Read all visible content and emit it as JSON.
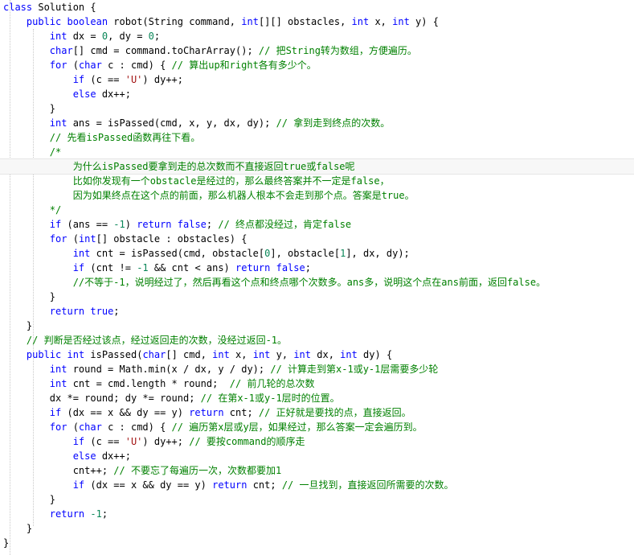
{
  "editor": {
    "language": "java",
    "current_line_index": 11,
    "lines": [
      [
        {
          "t": "class",
          "k": "k"
        },
        {
          "t": " Solution {",
          "k": "n"
        }
      ],
      [
        {
          "t": "    ",
          "k": "n"
        },
        {
          "t": "public",
          "k": "k"
        },
        {
          "t": " ",
          "k": "n"
        },
        {
          "t": "boolean",
          "k": "k"
        },
        {
          "t": " robot(String command, ",
          "k": "n"
        },
        {
          "t": "int",
          "k": "k"
        },
        {
          "t": "[][] obstacles, ",
          "k": "n"
        },
        {
          "t": "int",
          "k": "k"
        },
        {
          "t": " x, ",
          "k": "n"
        },
        {
          "t": "int",
          "k": "k"
        },
        {
          "t": " y) {",
          "k": "n"
        }
      ],
      [
        {
          "t": "        ",
          "k": "n"
        },
        {
          "t": "int",
          "k": "k"
        },
        {
          "t": " dx = ",
          "k": "n"
        },
        {
          "t": "0",
          "k": "num"
        },
        {
          "t": ", dy = ",
          "k": "n"
        },
        {
          "t": "0",
          "k": "num"
        },
        {
          "t": ";",
          "k": "n"
        }
      ],
      [
        {
          "t": "        ",
          "k": "n"
        },
        {
          "t": "char",
          "k": "k"
        },
        {
          "t": "[] cmd = command.toCharArray(); ",
          "k": "n"
        },
        {
          "t": "// 把String转为数组，方便遍历。",
          "k": "c"
        }
      ],
      [
        {
          "t": "        ",
          "k": "n"
        },
        {
          "t": "for",
          "k": "k"
        },
        {
          "t": " (",
          "k": "n"
        },
        {
          "t": "char",
          "k": "k"
        },
        {
          "t": " c : cmd) { ",
          "k": "n"
        },
        {
          "t": "// 算出up和right各有多少个。",
          "k": "c"
        }
      ],
      [
        {
          "t": "            ",
          "k": "n"
        },
        {
          "t": "if",
          "k": "k"
        },
        {
          "t": " (c == ",
          "k": "n"
        },
        {
          "t": "'U'",
          "k": "s"
        },
        {
          "t": ") dy++;",
          "k": "n"
        }
      ],
      [
        {
          "t": "            ",
          "k": "n"
        },
        {
          "t": "else",
          "k": "k"
        },
        {
          "t": " dx++;",
          "k": "n"
        }
      ],
      [
        {
          "t": "        }",
          "k": "n"
        }
      ],
      [
        {
          "t": "        ",
          "k": "n"
        },
        {
          "t": "int",
          "k": "k"
        },
        {
          "t": " ans = isPassed(cmd, x, y, dx, dy); ",
          "k": "n"
        },
        {
          "t": "// 拿到走到终点的次数。",
          "k": "c"
        }
      ],
      [
        {
          "t": "        ",
          "k": "n"
        },
        {
          "t": "// 先看isPassed函数再往下看。",
          "k": "c"
        }
      ],
      [
        {
          "t": "        ",
          "k": "n"
        },
        {
          "t": "/*",
          "k": "c"
        }
      ],
      [
        {
          "t": "            ",
          "k": "n"
        },
        {
          "t": "为什么isPassed要拿到走的总次数而不直接返回true或false呢",
          "k": "c"
        }
      ],
      [
        {
          "t": "            ",
          "k": "n"
        },
        {
          "t": "比如你发现有一个obstacle是经过的，那么最终答案并不一定是false，",
          "k": "c"
        }
      ],
      [
        {
          "t": "            ",
          "k": "n"
        },
        {
          "t": "因为如果终点在这个点的前面，那么机器人根本不会走到那个点。答案是true。",
          "k": "c"
        }
      ],
      [
        {
          "t": "        ",
          "k": "n"
        },
        {
          "t": "*/",
          "k": "c"
        }
      ],
      [
        {
          "t": "        ",
          "k": "n"
        },
        {
          "t": "if",
          "k": "k"
        },
        {
          "t": " (ans == ",
          "k": "n"
        },
        {
          "t": "-1",
          "k": "num"
        },
        {
          "t": ") ",
          "k": "n"
        },
        {
          "t": "return",
          "k": "k"
        },
        {
          "t": " ",
          "k": "n"
        },
        {
          "t": "false",
          "k": "k"
        },
        {
          "t": "; ",
          "k": "n"
        },
        {
          "t": "// 终点都没经过，肯定false",
          "k": "c"
        }
      ],
      [
        {
          "t": "        ",
          "k": "n"
        },
        {
          "t": "for",
          "k": "k"
        },
        {
          "t": " (",
          "k": "n"
        },
        {
          "t": "int",
          "k": "k"
        },
        {
          "t": "[] obstacle : obstacles) {",
          "k": "n"
        }
      ],
      [
        {
          "t": "            ",
          "k": "n"
        },
        {
          "t": "int",
          "k": "k"
        },
        {
          "t": " cnt = isPassed(cmd, obstacle[",
          "k": "n"
        },
        {
          "t": "0",
          "k": "num"
        },
        {
          "t": "], obstacle[",
          "k": "n"
        },
        {
          "t": "1",
          "k": "num"
        },
        {
          "t": "], dx, dy);",
          "k": "n"
        }
      ],
      [
        {
          "t": "            ",
          "k": "n"
        },
        {
          "t": "if",
          "k": "k"
        },
        {
          "t": " (cnt != ",
          "k": "n"
        },
        {
          "t": "-1",
          "k": "num"
        },
        {
          "t": " && cnt < ans) ",
          "k": "n"
        },
        {
          "t": "return",
          "k": "k"
        },
        {
          "t": " ",
          "k": "n"
        },
        {
          "t": "false",
          "k": "k"
        },
        {
          "t": ";",
          "k": "n"
        }
      ],
      [
        {
          "t": "            ",
          "k": "n"
        },
        {
          "t": "//不等于-1，说明经过了，然后再看这个点和终点哪个次数多。ans多，说明这个点在ans前面，返回false。",
          "k": "c"
        }
      ],
      [
        {
          "t": "        }",
          "k": "n"
        }
      ],
      [
        {
          "t": "        ",
          "k": "n"
        },
        {
          "t": "return",
          "k": "k"
        },
        {
          "t": " ",
          "k": "n"
        },
        {
          "t": "true",
          "k": "k"
        },
        {
          "t": ";",
          "k": "n"
        }
      ],
      [
        {
          "t": "    }",
          "k": "n"
        }
      ],
      [
        {
          "t": "    ",
          "k": "n"
        },
        {
          "t": "// 判断是否经过该点，经过返回走的次数，没经过返回-1。",
          "k": "c"
        }
      ],
      [
        {
          "t": "    ",
          "k": "n"
        },
        {
          "t": "public",
          "k": "k"
        },
        {
          "t": " ",
          "k": "n"
        },
        {
          "t": "int",
          "k": "k"
        },
        {
          "t": " isPassed(",
          "k": "n"
        },
        {
          "t": "char",
          "k": "k"
        },
        {
          "t": "[] cmd, ",
          "k": "n"
        },
        {
          "t": "int",
          "k": "k"
        },
        {
          "t": " x, ",
          "k": "n"
        },
        {
          "t": "int",
          "k": "k"
        },
        {
          "t": " y, ",
          "k": "n"
        },
        {
          "t": "int",
          "k": "k"
        },
        {
          "t": " dx, ",
          "k": "n"
        },
        {
          "t": "int",
          "k": "k"
        },
        {
          "t": " dy) {",
          "k": "n"
        }
      ],
      [
        {
          "t": "        ",
          "k": "n"
        },
        {
          "t": "int",
          "k": "k"
        },
        {
          "t": " round = Math.min(x / dx, y / dy); ",
          "k": "n"
        },
        {
          "t": "// 计算走到第x-1或y-1层需要多少轮",
          "k": "c"
        }
      ],
      [
        {
          "t": "        ",
          "k": "n"
        },
        {
          "t": "int",
          "k": "k"
        },
        {
          "t": " cnt = cmd.length * round;  ",
          "k": "n"
        },
        {
          "t": "// 前几轮的总次数",
          "k": "c"
        }
      ],
      [
        {
          "t": "        dx *= round; dy *= round; ",
          "k": "n"
        },
        {
          "t": "// 在第x-1或y-1层时的位置。",
          "k": "c"
        }
      ],
      [
        {
          "t": "        ",
          "k": "n"
        },
        {
          "t": "if",
          "k": "k"
        },
        {
          "t": " (dx == x && dy == y) ",
          "k": "n"
        },
        {
          "t": "return",
          "k": "k"
        },
        {
          "t": " cnt; ",
          "k": "n"
        },
        {
          "t": "// 正好就是要找的点，直接返回。",
          "k": "c"
        }
      ],
      [
        {
          "t": "        ",
          "k": "n"
        },
        {
          "t": "for",
          "k": "k"
        },
        {
          "t": " (",
          "k": "n"
        },
        {
          "t": "char",
          "k": "k"
        },
        {
          "t": " c : cmd) { ",
          "k": "n"
        },
        {
          "t": "// 遍历第x层或y层，如果经过，那么答案一定会遍历到。",
          "k": "c"
        }
      ],
      [
        {
          "t": "            ",
          "k": "n"
        },
        {
          "t": "if",
          "k": "k"
        },
        {
          "t": " (c == ",
          "k": "n"
        },
        {
          "t": "'U'",
          "k": "s"
        },
        {
          "t": ") dy++; ",
          "k": "n"
        },
        {
          "t": "// 要按command的顺序走",
          "k": "c"
        }
      ],
      [
        {
          "t": "            ",
          "k": "n"
        },
        {
          "t": "else",
          "k": "k"
        },
        {
          "t": " dx++;",
          "k": "n"
        }
      ],
      [
        {
          "t": "            cnt++; ",
          "k": "n"
        },
        {
          "t": "// 不要忘了每遍历一次，次数都要加1",
          "k": "c"
        }
      ],
      [
        {
          "t": "            ",
          "k": "n"
        },
        {
          "t": "if",
          "k": "k"
        },
        {
          "t": " (dx == x && dy == y) ",
          "k": "n"
        },
        {
          "t": "return",
          "k": "k"
        },
        {
          "t": " cnt; ",
          "k": "n"
        },
        {
          "t": "// 一旦找到，直接返回所需要的次数。",
          "k": "c"
        }
      ],
      [
        {
          "t": "        }",
          "k": "n"
        }
      ],
      [
        {
          "t": "        ",
          "k": "n"
        },
        {
          "t": "return",
          "k": "k"
        },
        {
          "t": " ",
          "k": "n"
        },
        {
          "t": "-1",
          "k": "num"
        },
        {
          "t": ";",
          "k": "n"
        }
      ],
      [
        {
          "t": "    }",
          "k": "n"
        }
      ],
      [
        {
          "t": "}",
          "k": "n"
        }
      ]
    ]
  }
}
